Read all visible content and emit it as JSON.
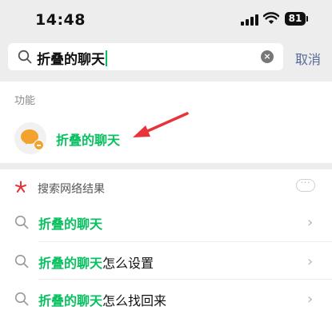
{
  "status": {
    "time": "14:48",
    "battery": "81"
  },
  "search": {
    "value": "折叠的聊天",
    "cancel_label": "取消"
  },
  "functions": {
    "label": "功能",
    "item": {
      "label": "折叠的聊天",
      "icon": "folded-chat-icon"
    }
  },
  "web": {
    "title": "搜索网络结果",
    "results": [
      {
        "highlight": "折叠的聊天",
        "rest": ""
      },
      {
        "highlight": "折叠的聊天",
        "rest": "怎么设置"
      },
      {
        "highlight": "折叠的聊天",
        "rest": "怎么找回来"
      }
    ]
  },
  "colors": {
    "accent": "#07c160",
    "link": "#576b95",
    "arrow": "#e8333a",
    "icon_orange": "#f3a22f",
    "header_bg": "#ededed"
  }
}
